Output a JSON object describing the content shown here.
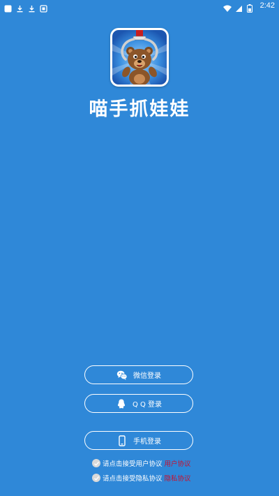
{
  "status_bar": {
    "time": "2:42",
    "left_icons": [
      "app-notification-icon",
      "download-icon",
      "download-icon",
      "media-icon"
    ],
    "right_icons": [
      "wifi-icon",
      "signal-icon",
      "battery-icon"
    ]
  },
  "app": {
    "title": "喵手抓娃娃",
    "icon": "claw-machine-bear-logo"
  },
  "login": {
    "wechat_label": "微信登录",
    "qq_label": "Q Q 登录",
    "phone_label": "手机登录"
  },
  "agreements": {
    "user_text": "请点击接受用户协议",
    "user_link": "用户协议",
    "privacy_text": "请点击接受隐私协议",
    "privacy_link": "隐私协议"
  },
  "colors": {
    "background": "#2f88d8",
    "link": "#c8102e",
    "button_border": "#ffffff"
  }
}
